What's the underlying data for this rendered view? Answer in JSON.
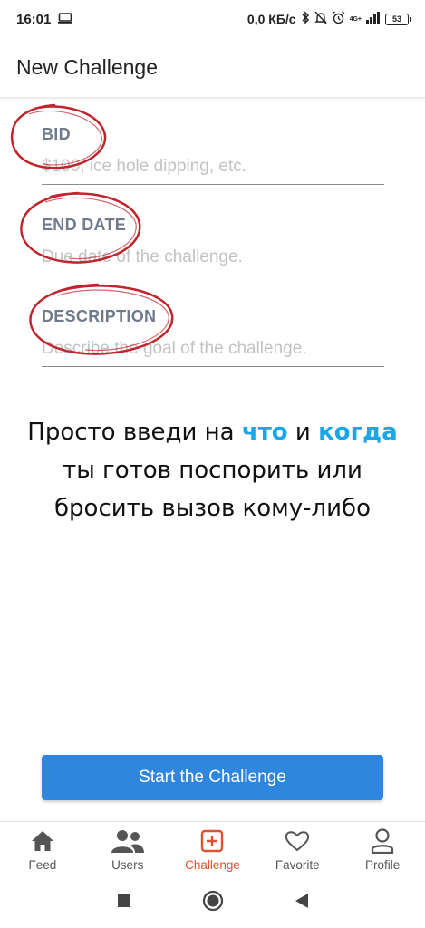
{
  "status": {
    "time": "16:01",
    "speed": "0,0 КБ/с",
    "network": "4G+",
    "battery": "53"
  },
  "header": {
    "title": "New Challenge"
  },
  "form": {
    "bid": {
      "label": "BID",
      "placeholder": "$100, ice hole dipping, etc."
    },
    "end_date": {
      "label": "END DATE",
      "placeholder": "Due date of the challenge."
    },
    "description": {
      "label": "DESCRIPTION",
      "placeholder": "Describe the goal of the challenge."
    }
  },
  "promo": {
    "part1": "Просто введи на ",
    "highlight1": "что",
    "part2": " и ",
    "highlight2": "когда",
    "line2": "ты готов поспорить или",
    "line3": "бросить вызов кому-либо",
    "highlight_color": "#1aa7e8"
  },
  "start_button": {
    "label": "Start the Challenge",
    "color": "#2f86de"
  },
  "nav": {
    "active_color": "#e0522f",
    "items": [
      {
        "label": "Feed",
        "icon": "home-icon"
      },
      {
        "label": "Users",
        "icon": "users-icon"
      },
      {
        "label": "Challenge",
        "icon": "plus-square-icon",
        "active": true
      },
      {
        "label": "Favorite",
        "icon": "heart-icon"
      },
      {
        "label": "Profile",
        "icon": "person-icon"
      }
    ]
  },
  "annotation_color": "#c0242c"
}
